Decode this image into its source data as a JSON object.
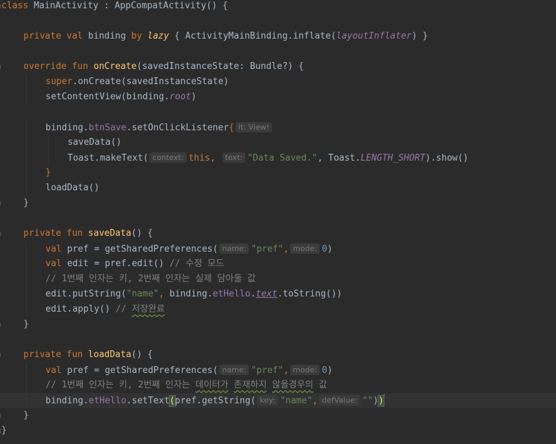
{
  "editor": {
    "lines": [
      {
        "indent": 0,
        "fold": true,
        "tokens": [
          {
            "t": "class ",
            "c": "kw"
          },
          {
            "t": "MainActivity : AppCompatActivity() {",
            "c": ""
          }
        ]
      },
      {
        "indent": 0,
        "tokens": []
      },
      {
        "indent": 1,
        "tokens": [
          {
            "t": "private val ",
            "c": "kw"
          },
          {
            "t": "binding ",
            "c": ""
          },
          {
            "t": "by ",
            "c": "kw"
          },
          {
            "t": "lazy",
            "c": "fn it"
          },
          {
            "t": " { ActivityMainBinding.inflate(",
            "c": ""
          },
          {
            "t": "layoutInflater",
            "c": "prop it"
          },
          {
            "t": ") }",
            "c": ""
          }
        ]
      },
      {
        "indent": 0,
        "tokens": []
      },
      {
        "indent": 1,
        "fold": true,
        "tokens": [
          {
            "t": "override fun ",
            "c": "kw"
          },
          {
            "t": "onCreate",
            "c": "fn"
          },
          {
            "t": "(savedInstanceState: Bundle?) {",
            "c": ""
          }
        ]
      },
      {
        "indent": 2,
        "tokens": [
          {
            "t": "super",
            "c": "kw"
          },
          {
            "t": ".onCreate(savedInstanceState)",
            "c": ""
          }
        ]
      },
      {
        "indent": 2,
        "tokens": [
          {
            "t": "setContentView(binding.",
            "c": ""
          },
          {
            "t": "root",
            "c": "prop it"
          },
          {
            "t": ")",
            "c": ""
          }
        ]
      },
      {
        "indent": 0,
        "tokens": []
      },
      {
        "indent": 2,
        "tokens": [
          {
            "t": "binding.",
            "c": ""
          },
          {
            "t": "btnSave",
            "c": "prop"
          },
          {
            "t": ".setOnClickListener",
            "c": ""
          },
          {
            "t": "{",
            "c": "kw"
          },
          {
            "t": "it: View!",
            "c": "hint"
          }
        ]
      },
      {
        "indent": 3,
        "tokens": [
          {
            "t": "saveData()",
            "c": ""
          }
        ]
      },
      {
        "indent": 3,
        "tokens": [
          {
            "t": "Toast.makeText(",
            "c": ""
          },
          {
            "t": "context:",
            "c": "hint"
          },
          {
            "t": "this",
            "c": "kw"
          },
          {
            "t": ", ",
            "c": "kw"
          },
          {
            "t": "text:",
            "c": "hint"
          },
          {
            "t": "\"Data Saved.\"",
            "c": "str"
          },
          {
            "t": ", Toast.",
            "c": ""
          },
          {
            "t": "LENGTH_SHORT",
            "c": "prop it"
          },
          {
            "t": ").show()",
            "c": ""
          }
        ]
      },
      {
        "indent": 2,
        "tokens": [
          {
            "t": "}",
            "c": "kw"
          }
        ]
      },
      {
        "indent": 2,
        "tokens": [
          {
            "t": "loadData()",
            "c": ""
          }
        ]
      },
      {
        "indent": 1,
        "fold": true,
        "tokens": [
          {
            "t": "}",
            "c": ""
          }
        ]
      },
      {
        "indent": 0,
        "tokens": []
      },
      {
        "indent": 1,
        "fold": true,
        "tokens": [
          {
            "t": "private fun ",
            "c": "kw"
          },
          {
            "t": "saveData",
            "c": "fn"
          },
          {
            "t": "() {",
            "c": ""
          }
        ]
      },
      {
        "indent": 2,
        "tokens": [
          {
            "t": "val ",
            "c": "kw"
          },
          {
            "t": "pref = getSharedPreferences(",
            "c": ""
          },
          {
            "t": "name:",
            "c": "hint"
          },
          {
            "t": "\"pref\"",
            "c": "str"
          },
          {
            "t": ",",
            "c": "kw"
          },
          {
            "t": "mode:",
            "c": "hint"
          },
          {
            "t": "0",
            "c": "num"
          },
          {
            "t": ")",
            "c": ""
          }
        ]
      },
      {
        "indent": 2,
        "tokens": [
          {
            "t": "val ",
            "c": "kw"
          },
          {
            "t": "edit = pref.edit() ",
            "c": ""
          },
          {
            "t": "// 수정 모드",
            "c": "cmt"
          }
        ]
      },
      {
        "indent": 2,
        "tokens": [
          {
            "t": "// 1번째 인자는 키, 2번째 인자는 실제 담아둘 값",
            "c": "cmt"
          }
        ]
      },
      {
        "indent": 2,
        "tokens": [
          {
            "t": "edit.putString(",
            "c": ""
          },
          {
            "t": "\"name\"",
            "c": "str"
          },
          {
            "t": ", ",
            "c": "kw"
          },
          {
            "t": "binding.",
            "c": ""
          },
          {
            "t": "etHello",
            "c": "prop"
          },
          {
            "t": ".",
            "c": ""
          },
          {
            "t": "text",
            "c": "prop it under"
          },
          {
            "t": ".toString())",
            "c": ""
          }
        ]
      },
      {
        "indent": 2,
        "tokens": [
          {
            "t": "edit.apply() ",
            "c": ""
          },
          {
            "t": "// ",
            "c": "cmt"
          },
          {
            "t": "저장완료",
            "c": "cmt wavy"
          }
        ]
      },
      {
        "indent": 1,
        "fold": true,
        "tokens": [
          {
            "t": "}",
            "c": ""
          }
        ]
      },
      {
        "indent": 0,
        "tokens": []
      },
      {
        "indent": 1,
        "fold": true,
        "tokens": [
          {
            "t": "private fun ",
            "c": "kw"
          },
          {
            "t": "loadData",
            "c": "fn"
          },
          {
            "t": "() {",
            "c": ""
          }
        ]
      },
      {
        "indent": 2,
        "tokens": [
          {
            "t": "val ",
            "c": "kw"
          },
          {
            "t": "pref = getSharedPreferences(",
            "c": ""
          },
          {
            "t": "name:",
            "c": "hint"
          },
          {
            "t": "\"pref\"",
            "c": "str"
          },
          {
            "t": ",",
            "c": "kw"
          },
          {
            "t": "mode:",
            "c": "hint"
          },
          {
            "t": "0",
            "c": "num"
          },
          {
            "t": ")",
            "c": ""
          }
        ]
      },
      {
        "indent": 2,
        "tokens": [
          {
            "t": "// 1번째 인자는 키, 2번째 인자는 ",
            "c": "cmt"
          },
          {
            "t": "데이터가",
            "c": "cmt wavy"
          },
          {
            "t": " ",
            "c": "cmt"
          },
          {
            "t": "존재하지",
            "c": "cmt wavy"
          },
          {
            "t": " ",
            "c": "cmt"
          },
          {
            "t": "않을경우의",
            "c": "cmt wavy"
          },
          {
            "t": " 값",
            "c": "cmt"
          }
        ]
      },
      {
        "indent": 2,
        "current": true,
        "tokens": [
          {
            "t": "binding.",
            "c": ""
          },
          {
            "t": "etHello",
            "c": "prop"
          },
          {
            "t": ".setText",
            "c": ""
          },
          {
            "t": "(",
            "c": "brace-match"
          },
          {
            "t": "pref.getString(",
            "c": ""
          },
          {
            "t": "key:",
            "c": "hint"
          },
          {
            "t": "\"name\"",
            "c": "str"
          },
          {
            "t": ",",
            "c": "kw"
          },
          {
            "t": "defValue:",
            "c": "hint"
          },
          {
            "t": "\"\"",
            "c": "str"
          },
          {
            "t": ")",
            "c": ""
          },
          {
            "t": ")",
            "c": "brace-match"
          },
          {
            "t": "",
            "c": "caret"
          }
        ]
      },
      {
        "indent": 1,
        "fold": true,
        "tokens": [
          {
            "t": "}",
            "c": ""
          }
        ]
      },
      {
        "indent": 0,
        "fold": true,
        "tokens": [
          {
            "t": "}",
            "c": ""
          }
        ]
      }
    ]
  }
}
